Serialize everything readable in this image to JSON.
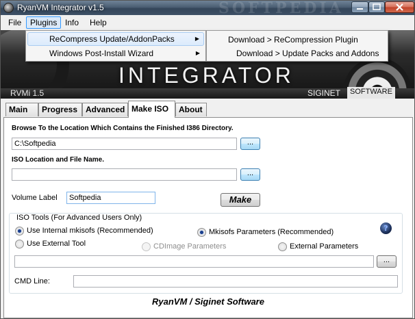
{
  "window": {
    "title": "RyanVM Integrator v1.5",
    "watermark": "SOFTPEDIA"
  },
  "menubar": {
    "items": [
      "File",
      "Plugins",
      "Info",
      "Help"
    ]
  },
  "plugins_menu": {
    "items": [
      {
        "label": "ReCompress Update/AddonPacks"
      },
      {
        "label": "Windows Post-Install Wizard"
      }
    ],
    "submenu": [
      "Download > ReCompression Plugin",
      "Download > Update Packs and Addons"
    ]
  },
  "banner": {
    "logo": "INTEGRATOR",
    "version": "RVMi 1.5",
    "brand": "SIGINET",
    "brand_software": "SOFTWARE"
  },
  "tabs": [
    "Main",
    "Progress",
    "Advanced",
    "Make ISO",
    "About"
  ],
  "active_tab": "Make ISO",
  "make_iso": {
    "browse_label": "Browse To the Location Which Contains the Finished I386 Directory.",
    "browse_value": "C:\\Softpedia",
    "iso_label": "ISO Location and File Name.",
    "iso_value": "",
    "volume_label": "Volume Label",
    "volume_value": "Softpedia",
    "browse_button": "...",
    "make_button": "Make",
    "iso_tools": {
      "legend": "ISO Tools (For Advanced Users Only)",
      "use_internal": "Use Internal mkisofs (Recommended)",
      "use_external": "Use External Tool",
      "mkisofs_params": "Mkisofs Parameters (Recommended)",
      "cdimage_params": "CDImage Parameters",
      "external_params": "External Parameters",
      "cmd_label": "CMD Line:",
      "tool_path_value": "",
      "cmd_value": "",
      "help_glyph": "?"
    }
  },
  "footer": "RyanVM / Siginet Software"
}
